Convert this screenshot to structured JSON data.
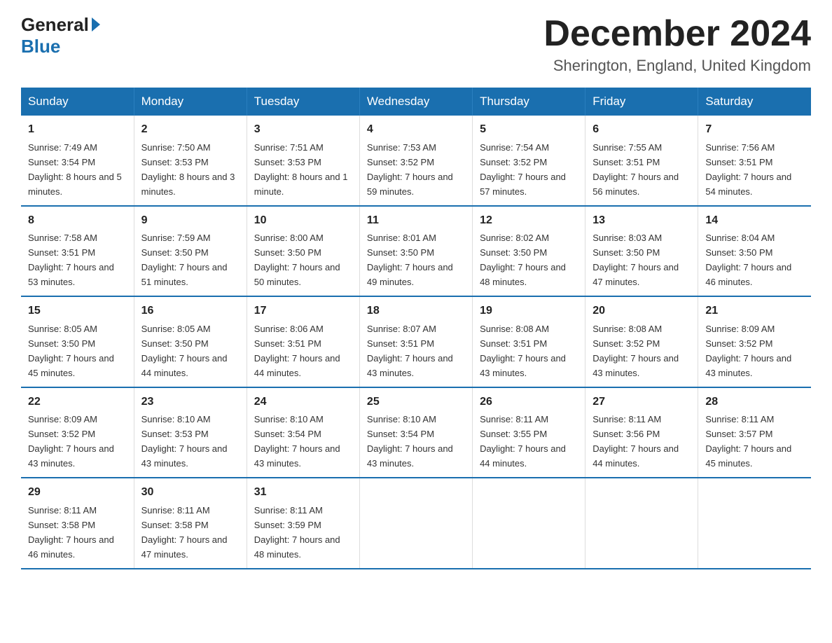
{
  "logo": {
    "general": "General",
    "blue": "Blue"
  },
  "header": {
    "month": "December 2024",
    "location": "Sherington, England, United Kingdom"
  },
  "days_of_week": [
    "Sunday",
    "Monday",
    "Tuesday",
    "Wednesday",
    "Thursday",
    "Friday",
    "Saturday"
  ],
  "weeks": [
    [
      {
        "day": "1",
        "sunrise": "7:49 AM",
        "sunset": "3:54 PM",
        "daylight": "8 hours and 5 minutes."
      },
      {
        "day": "2",
        "sunrise": "7:50 AM",
        "sunset": "3:53 PM",
        "daylight": "8 hours and 3 minutes."
      },
      {
        "day": "3",
        "sunrise": "7:51 AM",
        "sunset": "3:53 PM",
        "daylight": "8 hours and 1 minute."
      },
      {
        "day": "4",
        "sunrise": "7:53 AM",
        "sunset": "3:52 PM",
        "daylight": "7 hours and 59 minutes."
      },
      {
        "day": "5",
        "sunrise": "7:54 AM",
        "sunset": "3:52 PM",
        "daylight": "7 hours and 57 minutes."
      },
      {
        "day": "6",
        "sunrise": "7:55 AM",
        "sunset": "3:51 PM",
        "daylight": "7 hours and 56 minutes."
      },
      {
        "day": "7",
        "sunrise": "7:56 AM",
        "sunset": "3:51 PM",
        "daylight": "7 hours and 54 minutes."
      }
    ],
    [
      {
        "day": "8",
        "sunrise": "7:58 AM",
        "sunset": "3:51 PM",
        "daylight": "7 hours and 53 minutes."
      },
      {
        "day": "9",
        "sunrise": "7:59 AM",
        "sunset": "3:50 PM",
        "daylight": "7 hours and 51 minutes."
      },
      {
        "day": "10",
        "sunrise": "8:00 AM",
        "sunset": "3:50 PM",
        "daylight": "7 hours and 50 minutes."
      },
      {
        "day": "11",
        "sunrise": "8:01 AM",
        "sunset": "3:50 PM",
        "daylight": "7 hours and 49 minutes."
      },
      {
        "day": "12",
        "sunrise": "8:02 AM",
        "sunset": "3:50 PM",
        "daylight": "7 hours and 48 minutes."
      },
      {
        "day": "13",
        "sunrise": "8:03 AM",
        "sunset": "3:50 PM",
        "daylight": "7 hours and 47 minutes."
      },
      {
        "day": "14",
        "sunrise": "8:04 AM",
        "sunset": "3:50 PM",
        "daylight": "7 hours and 46 minutes."
      }
    ],
    [
      {
        "day": "15",
        "sunrise": "8:05 AM",
        "sunset": "3:50 PM",
        "daylight": "7 hours and 45 minutes."
      },
      {
        "day": "16",
        "sunrise": "8:05 AM",
        "sunset": "3:50 PM",
        "daylight": "7 hours and 44 minutes."
      },
      {
        "day": "17",
        "sunrise": "8:06 AM",
        "sunset": "3:51 PM",
        "daylight": "7 hours and 44 minutes."
      },
      {
        "day": "18",
        "sunrise": "8:07 AM",
        "sunset": "3:51 PM",
        "daylight": "7 hours and 43 minutes."
      },
      {
        "day": "19",
        "sunrise": "8:08 AM",
        "sunset": "3:51 PM",
        "daylight": "7 hours and 43 minutes."
      },
      {
        "day": "20",
        "sunrise": "8:08 AM",
        "sunset": "3:52 PM",
        "daylight": "7 hours and 43 minutes."
      },
      {
        "day": "21",
        "sunrise": "8:09 AM",
        "sunset": "3:52 PM",
        "daylight": "7 hours and 43 minutes."
      }
    ],
    [
      {
        "day": "22",
        "sunrise": "8:09 AM",
        "sunset": "3:52 PM",
        "daylight": "7 hours and 43 minutes."
      },
      {
        "day": "23",
        "sunrise": "8:10 AM",
        "sunset": "3:53 PM",
        "daylight": "7 hours and 43 minutes."
      },
      {
        "day": "24",
        "sunrise": "8:10 AM",
        "sunset": "3:54 PM",
        "daylight": "7 hours and 43 minutes."
      },
      {
        "day": "25",
        "sunrise": "8:10 AM",
        "sunset": "3:54 PM",
        "daylight": "7 hours and 43 minutes."
      },
      {
        "day": "26",
        "sunrise": "8:11 AM",
        "sunset": "3:55 PM",
        "daylight": "7 hours and 44 minutes."
      },
      {
        "day": "27",
        "sunrise": "8:11 AM",
        "sunset": "3:56 PM",
        "daylight": "7 hours and 44 minutes."
      },
      {
        "day": "28",
        "sunrise": "8:11 AM",
        "sunset": "3:57 PM",
        "daylight": "7 hours and 45 minutes."
      }
    ],
    [
      {
        "day": "29",
        "sunrise": "8:11 AM",
        "sunset": "3:58 PM",
        "daylight": "7 hours and 46 minutes."
      },
      {
        "day": "30",
        "sunrise": "8:11 AM",
        "sunset": "3:58 PM",
        "daylight": "7 hours and 47 minutes."
      },
      {
        "day": "31",
        "sunrise": "8:11 AM",
        "sunset": "3:59 PM",
        "daylight": "7 hours and 48 minutes."
      },
      null,
      null,
      null,
      null
    ]
  ]
}
